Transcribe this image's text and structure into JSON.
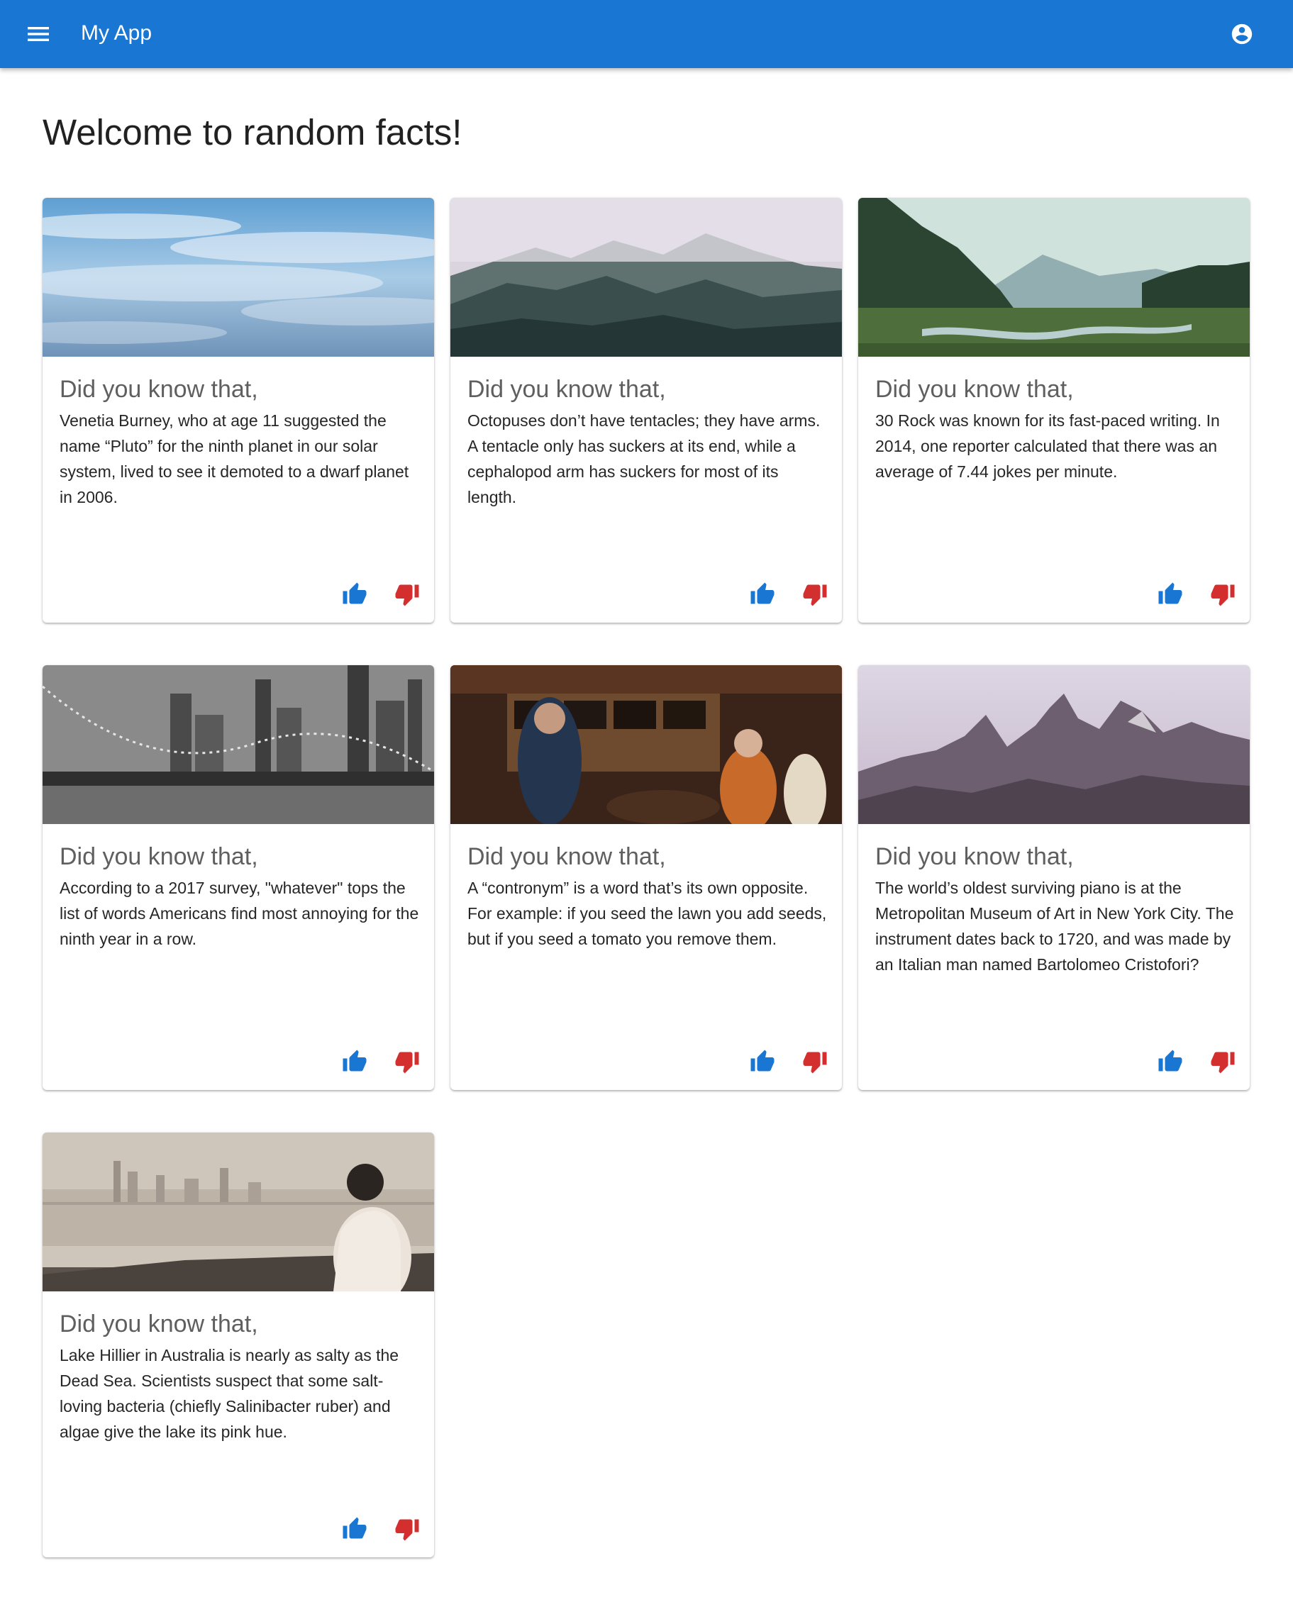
{
  "appbar": {
    "title": "My App",
    "menu_icon": "menu-icon",
    "account_icon": "account-circle-icon",
    "color": "#1976d2"
  },
  "page": {
    "title": "Welcome to random facts!"
  },
  "colors": {
    "like": "#1976d2",
    "dislike": "#d32f2f"
  },
  "cards": [
    {
      "image": "sky-clouds",
      "heading": "Did you know that,",
      "text": "Venetia Burney, who at age 11 suggested the name “Pluto” for the ninth planet in our solar system, lived to see it demoted to a dwarf planet in 2006."
    },
    {
      "image": "foggy-mountains",
      "heading": "Did you know that,",
      "text": "Octopuses don’t have tentacles; they have arms. A tentacle only has suckers at its end, while a cephalopod arm has suckers for most of its length."
    },
    {
      "image": "forest-river-valley",
      "heading": "Did you know that,",
      "text": "30 Rock was known for its fast-paced writing. In 2014, one reporter calculated that there was an average of 7.44 jokes per minute."
    },
    {
      "image": "bridge-city-night",
      "heading": "Did you know that,",
      "text": "According to a 2017 survey, \"whatever\" tops the list of words Americans find most annoying for the ninth year in a row."
    },
    {
      "image": "crowded-bar",
      "heading": "Did you know that,",
      "text": "A “contronym” is a word that’s its own opposite. For example: if you seed the lawn you add seeds, but if you seed a tomato you remove them."
    },
    {
      "image": "rocky-peaks-dusk",
      "heading": "Did you know that,",
      "text": "The world’s oldest surviving piano is at the Metropolitan Museum of Art in New York City. The instrument dates back to 1720, and was made by an Italian man named Bartolomeo Cristofori?"
    },
    {
      "image": "person-lakeside-skyline",
      "heading": "Did you know that,",
      "text": "Lake Hillier in Australia is nearly as salty as the Dead Sea. Scientists suspect that some salt-loving bacteria (chiefly Salinibacter ruber) and algae give the lake its pink hue."
    }
  ]
}
